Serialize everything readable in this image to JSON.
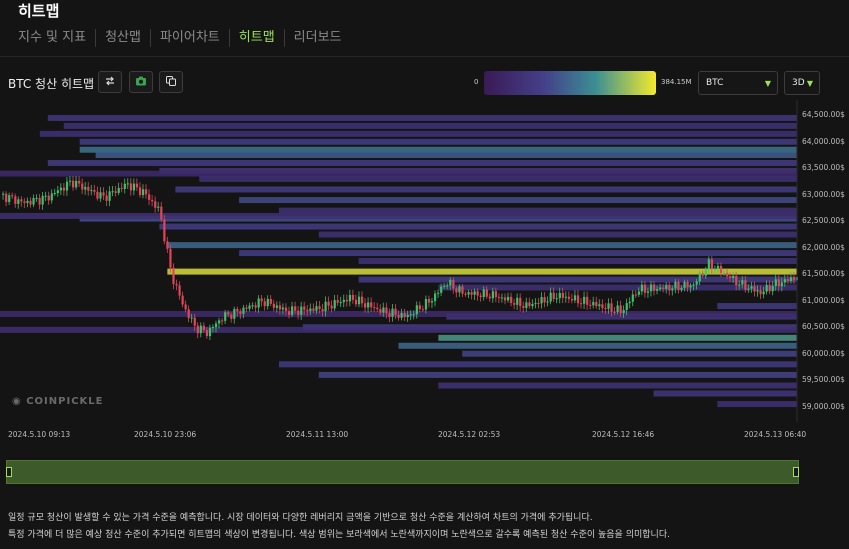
{
  "page": {
    "title": "히트맵"
  },
  "tabs": [
    {
      "label": "지수 및 지표",
      "active": false
    },
    {
      "label": "청산맵",
      "active": false
    },
    {
      "label": "파이어차트",
      "active": false
    },
    {
      "label": "히트맵",
      "active": true
    },
    {
      "label": "리더보드",
      "active": false
    }
  ],
  "toolbar": {
    "chart_title": "BTC 청산 히트맵",
    "swap_icon": "swap-arrows-icon",
    "camera_icon": "camera-icon",
    "copy_icon": "copy-icon"
  },
  "color_scale": {
    "min_label": "0",
    "max_label": "384.15M",
    "colors": [
      "#3a1a55",
      "#44408a",
      "#3b8f93",
      "#f3ea2c"
    ]
  },
  "selectors": {
    "coin": {
      "value": "BTC"
    },
    "period": {
      "value": "3D"
    }
  },
  "chart_data": {
    "type": "heatmap",
    "y_ticks": [
      "64,500.00$",
      "64,000.00$",
      "63,500.00$",
      "63,000.00$",
      "62,500.00$",
      "62,000.00$",
      "61,500.00$",
      "61,000.00$",
      "60,500.00$",
      "60,000.00$",
      "59,500.00$",
      "59,000.00$"
    ],
    "x_ticks": [
      "2024.5.10 09:13",
      "2024.5.10 23:06",
      "2024.5.11 13:00",
      "2024.5.12 02:53",
      "2024.5.12 16:46",
      "2024.5.13 06:40"
    ],
    "ylim": [
      58900,
      64600
    ],
    "price_path": [
      [
        0,
        63000
      ],
      [
        0.03,
        62850
      ],
      [
        0.06,
        62950
      ],
      [
        0.09,
        63250
      ],
      [
        0.11,
        63100
      ],
      [
        0.13,
        62950
      ],
      [
        0.16,
        63200
      ],
      [
        0.18,
        63050
      ],
      [
        0.2,
        62700
      ],
      [
        0.215,
        61500
      ],
      [
        0.23,
        60900
      ],
      [
        0.245,
        60500
      ],
      [
        0.26,
        60400
      ],
      [
        0.28,
        60700
      ],
      [
        0.3,
        60800
      ],
      [
        0.33,
        61000
      ],
      [
        0.36,
        60800
      ],
      [
        0.4,
        60850
      ],
      [
        0.44,
        61050
      ],
      [
        0.48,
        60800
      ],
      [
        0.51,
        60700
      ],
      [
        0.54,
        61000
      ],
      [
        0.56,
        61350
      ],
      [
        0.58,
        61150
      ],
      [
        0.62,
        61100
      ],
      [
        0.66,
        60900
      ],
      [
        0.7,
        61100
      ],
      [
        0.74,
        60950
      ],
      [
        0.78,
        60800
      ],
      [
        0.8,
        61200
      ],
      [
        0.84,
        61250
      ],
      [
        0.87,
        61300
      ],
      [
        0.89,
        61700
      ],
      [
        0.91,
        61500
      ],
      [
        0.93,
        61300
      ],
      [
        0.955,
        61150
      ],
      [
        0.97,
        61300
      ],
      [
        1.0,
        61450
      ]
    ],
    "bands": [
      {
        "price": 64450,
        "start": 0.06,
        "intensity": 0.25
      },
      {
        "price": 64300,
        "start": 0.08,
        "intensity": 0.22
      },
      {
        "price": 64150,
        "start": 0.05,
        "intensity": 0.2
      },
      {
        "price": 64000,
        "start": 0.1,
        "intensity": 0.3
      },
      {
        "price": 63850,
        "start": 0.1,
        "intensity": 0.55
      },
      {
        "price": 63750,
        "start": 0.12,
        "intensity": 0.45
      },
      {
        "price": 63600,
        "start": 0.06,
        "intensity": 0.3
      },
      {
        "price": 63450,
        "start": 0.2,
        "intensity": 0.25
      },
      {
        "price": 63300,
        "start": 0.25,
        "intensity": 0.2
      },
      {
        "price": 63100,
        "start": 0.22,
        "intensity": 0.3
      },
      {
        "price": 62900,
        "start": 0.3,
        "intensity": 0.38
      },
      {
        "price": 62700,
        "start": 0.35,
        "intensity": 0.2
      },
      {
        "price": 62550,
        "start": 0.1,
        "intensity": 0.4
      },
      {
        "price": 62400,
        "start": 0.2,
        "intensity": 0.3
      },
      {
        "price": 62250,
        "start": 0.4,
        "intensity": 0.22
      },
      {
        "price": 62050,
        "start": 0.21,
        "intensity": 0.5
      },
      {
        "price": 61900,
        "start": 0.3,
        "intensity": 0.3
      },
      {
        "price": 61750,
        "start": 0.45,
        "intensity": 0.22
      },
      {
        "price": 61550,
        "start": 0.21,
        "intensity": 0.95
      },
      {
        "price": 61400,
        "start": 0.45,
        "intensity": 0.3
      },
      {
        "price": 61250,
        "start": 0.55,
        "intensity": 0.2
      },
      {
        "price": 60900,
        "start": 0.9,
        "intensity": 0.28
      },
      {
        "price": 60700,
        "start": 0.56,
        "intensity": 0.25
      },
      {
        "price": 60500,
        "start": 0.38,
        "intensity": 0.3
      },
      {
        "price": 60300,
        "start": 0.55,
        "intensity": 0.7
      },
      {
        "price": 60150,
        "start": 0.5,
        "intensity": 0.5
      },
      {
        "price": 60000,
        "start": 0.58,
        "intensity": 0.35
      },
      {
        "price": 59800,
        "start": 0.35,
        "intensity": 0.28
      },
      {
        "price": 59600,
        "start": 0.4,
        "intensity": 0.35
      },
      {
        "price": 59400,
        "start": 0.55,
        "intensity": 0.22
      },
      {
        "price": 59250,
        "start": 0.82,
        "intensity": 0.25
      },
      {
        "price": 59050,
        "start": 0.9,
        "intensity": 0.2
      },
      {
        "price": 62600,
        "start": 0.0,
        "intensity": 0.18
      },
      {
        "price": 60750,
        "start": 0.0,
        "intensity": 0.15
      },
      {
        "price": 60450,
        "start": 0.0,
        "intensity": 0.18
      },
      {
        "price": 63400,
        "start": 0.0,
        "intensity": 0.14
      }
    ]
  },
  "watermark": "COINPICKLE",
  "description": {
    "line1": "일정 규모 청산이 발생할 수 있는 가격 수준을 예측합니다. 시장 데이터와 다양한 레버리지 금액을 기반으로 청산 수준을 계산하여 차트의 가격에 추가됩니다.",
    "line2": "특정 가격에 더 많은 예상 청산 수준이 추가되면 히트맵의 색상이 변경됩니다. 색상 범위는 보라색에서 노란색까지이며 노란색으로 갈수록 예측된 청산 수준이 높음을 의미합니다."
  }
}
